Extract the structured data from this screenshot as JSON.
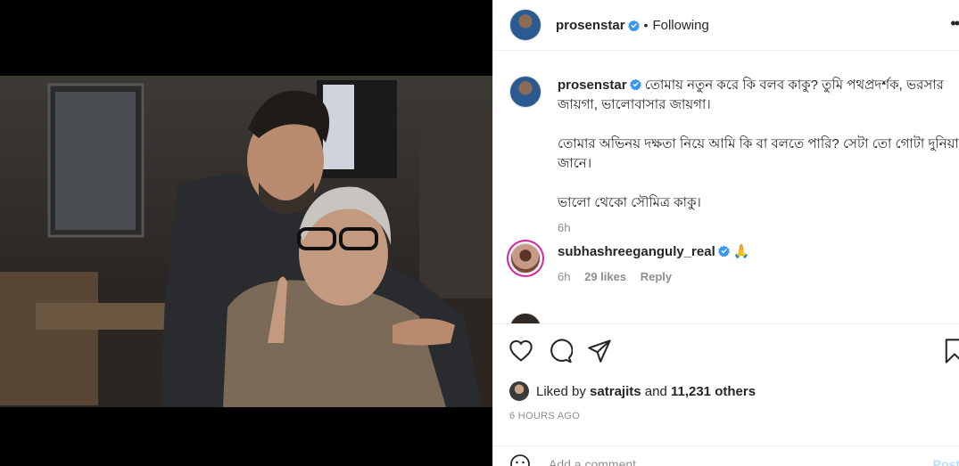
{
  "post": {
    "author": "prosenstar",
    "follow_status": "Following",
    "separator": "•",
    "more_glyph": "••",
    "caption": "তোমায় নতুন করে কি বলব কাকু? তুমি পথপ্রদর্শক, ভরসার জায়গা, ভালোবাসার জায়গা।\n\nতোমার অভিনয় দক্ষতা নিয়ে আমি কি বা বলতে পারি? সেটা তো গোটা দুনিয়া জানে।\n\nভালো থেকো সৌমিত্র কাকু।",
    "caption_time": "6h"
  },
  "comments": [
    {
      "user": "subhashreeganguly_real",
      "text": "🙏",
      "time": "6h",
      "likes": "29 likes",
      "reply_label": "Reply"
    }
  ],
  "likes": {
    "prefix": "Liked by",
    "user": "satrajits",
    "connector": "and",
    "others": "11,231 others"
  },
  "timestamp": "6 HOURS AGO",
  "composer": {
    "placeholder": "Add a comment...",
    "post_label": "Post"
  },
  "colors": {
    "verified": "#3897f0",
    "muted": "#8e8e8e",
    "text": "#262626",
    "post_disabled": "#b2dffc"
  },
  "icons": [
    "heart-icon",
    "comment-icon",
    "share-icon",
    "bookmark-icon",
    "verified-icon",
    "emoji-icon",
    "more-icon"
  ]
}
